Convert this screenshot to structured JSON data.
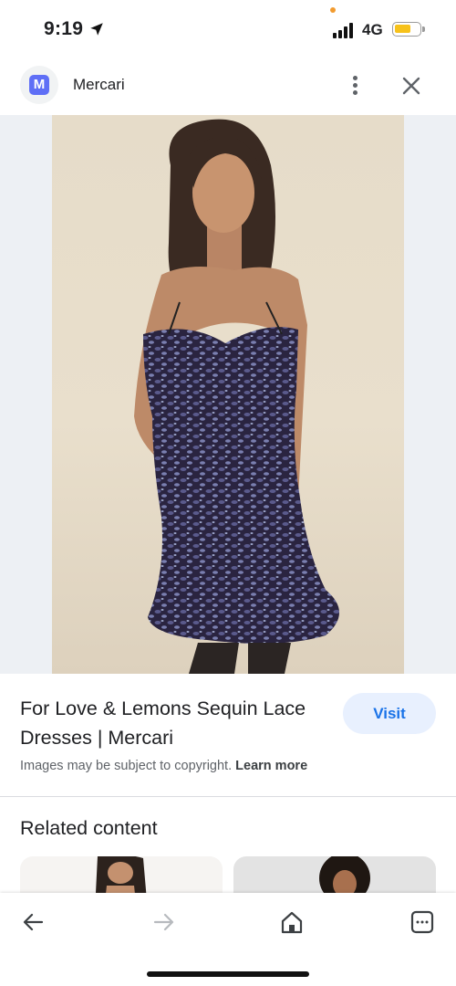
{
  "status_bar": {
    "time": "9:19",
    "network": "4G",
    "icons": [
      "location-arrow-icon",
      "signal-bars-icon",
      "battery-icon"
    ]
  },
  "source": {
    "logo_letter": "M",
    "name": "Mercari",
    "icons": [
      "more-vert-icon",
      "close-icon"
    ]
  },
  "image": {
    "subject": "Model wearing dark sequin lace mini dress",
    "lens_icon": "google-lens-icon"
  },
  "result": {
    "title": "For Love & Lemons Sequin Lace Dresses | Mercari",
    "visit_label": "Visit",
    "copyright_text": "Images may be subject to copyright.",
    "learn_more_label": "Learn more"
  },
  "related": {
    "title": "Related content"
  },
  "bottom_nav": {
    "icons": [
      "back-arrow-icon",
      "forward-arrow-icon",
      "home-icon",
      "tabs-icon"
    ]
  },
  "colors": {
    "accent": "#1a73e8",
    "visit_bg": "#e8f0fe",
    "brand": "#5f6ff6",
    "battery": "#f7c21b"
  }
}
